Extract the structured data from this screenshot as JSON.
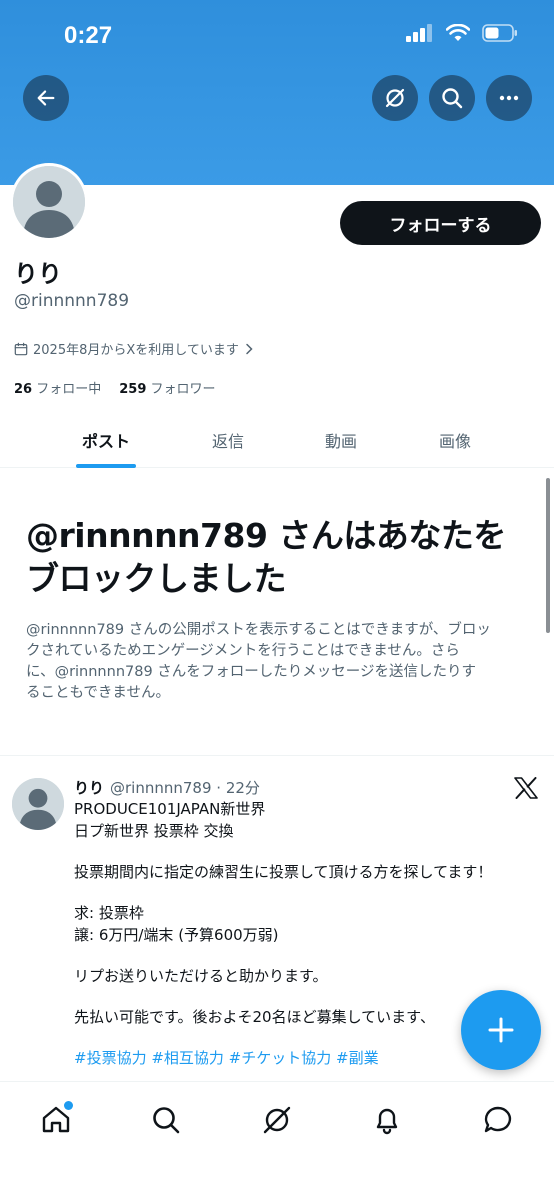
{
  "status_bar": {
    "time": "0:27"
  },
  "profile": {
    "display_name": "りり",
    "handle": "@rinnnnn789",
    "joined": "2025年8月からXを利用しています",
    "following_count": "26",
    "following_label": "フォロー中",
    "followers_count": "259",
    "followers_label": "フォロワー",
    "follow_button": "フォローする"
  },
  "tabs": [
    {
      "label": "ポスト",
      "active": true
    },
    {
      "label": "返信",
      "active": false
    },
    {
      "label": "動画",
      "active": false
    },
    {
      "label": "画像",
      "active": false
    }
  ],
  "blocked": {
    "title_line1": "@rinnnnn789 さんはあなたを",
    "title_line2": "ブロックしました",
    "body_line1": "@rinnnnn789 さんの公開ポストを表示することはできますが、ブロッ",
    "body_line2": "クされているためエンゲージメントを行うことはできません。さら",
    "body_line3": "に、@rinnnnn789 さんをフォローしたりメッセージを送信したりす",
    "body_line4": "ることもできません。"
  },
  "post": {
    "name": "りり",
    "meta": "@rinnnnn789 · 22分",
    "lines": {
      "l1": "PRODUCE101JAPAN新世界",
      "l2": "日プ新世界 投票枠 交換",
      "l3": "投票期間内に指定の練習生に投票して頂ける方を探してます！",
      "l4": "求: 投票枠",
      "l5": "譲: 6万円/端末 (予算600万弱)",
      "l6": "リプお送りいただけると助かります。",
      "l7": "先払い可能です。後およそ20名ほど募集しています、",
      "hashtags": "#投票協力 #相互協力 #チケット協力 #副業"
    }
  },
  "icons": {
    "back": "arrow-left-icon",
    "grok": "grok-icon",
    "search": "search-icon",
    "more": "more-icon",
    "calendar": "calendar-icon",
    "x_logo": "x-logo-icon",
    "compose": "plus-icon",
    "nav": [
      "home-icon",
      "search-icon",
      "grok-icon",
      "bell-icon",
      "messages-icon"
    ]
  },
  "colors": {
    "banner": "#2f8fdc",
    "accent": "#1d9bf0",
    "text": "#0f1419",
    "muted": "#536471"
  }
}
